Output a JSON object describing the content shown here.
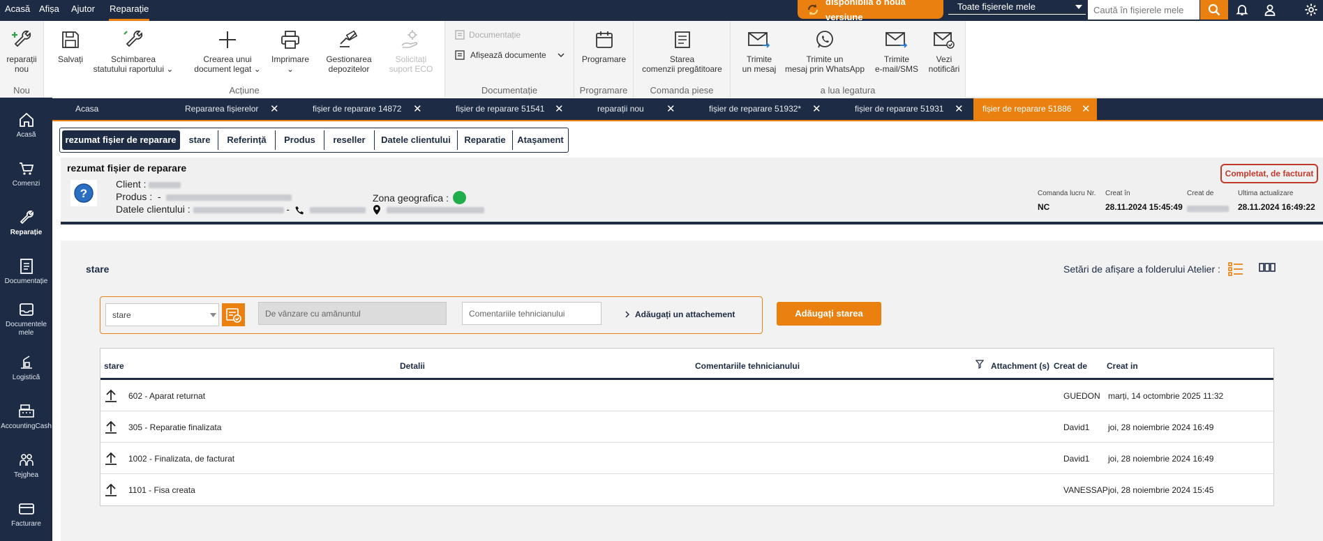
{
  "topbar": {
    "menus": [
      "Acasă",
      "Afișa",
      "Ajutor",
      "Reparație"
    ],
    "update_label": "disponibilă o nouă versiune",
    "file_select": "Toate fișierele mele",
    "search_placeholder": "Caută în fișierele mele"
  },
  "ribbon": {
    "groups": {
      "nou": "Nou",
      "actiune": "Acțiune",
      "documentatie": "Documentație",
      "programare": "Programare",
      "comanda": "Comanda piese",
      "legatura": "a lua legatura"
    },
    "buttons": {
      "reparatii_nou": [
        "reparații",
        "nou"
      ],
      "salvati": [
        "Salvați"
      ],
      "schimbarea": [
        "Schimbarea",
        "statutului raportului"
      ],
      "crearea": [
        "Crearea unui",
        "document legat"
      ],
      "imprimare": [
        "Imprimare"
      ],
      "gestionarea": [
        "Gestionarea",
        "depozitelor"
      ],
      "solicitati": [
        "Solicitați",
        "suport ECO"
      ],
      "documentatie": "Documentație",
      "afiseaza": "Afișează documente",
      "programare": [
        "Programare"
      ],
      "starea": [
        "Starea",
        "comenzii pregătitoare"
      ],
      "trimite_mesaj": [
        "Trimite",
        "un mesaj"
      ],
      "whatsapp": [
        "Trimite un",
        "mesaj prin WhatsApp"
      ],
      "email": [
        "Trimite",
        "e-mail/SMS"
      ],
      "notificari": [
        "Vezi",
        "notificări"
      ]
    }
  },
  "sidebar": [
    {
      "label": "Acasă",
      "icon": "home-icon"
    },
    {
      "label": "Comenzi",
      "icon": "cart-icon"
    },
    {
      "label": "Reparație",
      "icon": "wrench-icon"
    },
    {
      "label": "Documentație",
      "icon": "document-icon"
    },
    {
      "label": "Documentele mele",
      "icon": "inbox-icon"
    },
    {
      "label": "Logistică",
      "icon": "logistics-icon"
    },
    {
      "label": "AccountingCash",
      "icon": "cash-register-icon"
    },
    {
      "label": "Tejghea",
      "icon": "people-icon"
    },
    {
      "label": "Facturare",
      "icon": "card-icon"
    }
  ],
  "tabs": [
    {
      "label": "Acasa"
    },
    {
      "label": "Repararea fișierelor"
    },
    {
      "label": "fișier de reparare 14872"
    },
    {
      "label": "fișier de reparare 51541"
    },
    {
      "label": "reparații nou"
    },
    {
      "label": "fișier de reparare 51932*"
    },
    {
      "label": "fișier de reparare 51931"
    },
    {
      "label": "fișier de reparare 51886"
    }
  ],
  "subtabs": [
    "rezumat fișier de reparare",
    "stare",
    "Referință",
    "Produs",
    "reseller",
    "Datele clientului",
    "Reparatie",
    "Atașament"
  ],
  "header": {
    "title": "rezumat fișier de reparare",
    "client_label": "Client :",
    "produs_label": "Produs :",
    "produs_sep": "-",
    "datele_label": "Datele clientului :",
    "datele_sep": "-",
    "zona_label": "Zona geografica :",
    "status_badge": "Completat, de facturat",
    "meta": {
      "comanda_label": "Comanda lucru Nr.",
      "comanda_value": "NC",
      "creat_in_label": "Creat în",
      "creat_in_value": "28.11.2024 15:45:49",
      "creat_de_label": "Creat de",
      "ultima_label": "Ultima actualizare",
      "ultima_value": "28.11.2024 16:49:22"
    }
  },
  "stare": {
    "section_title": "stare",
    "display_settings": "Setări de afișare a folderului Atelier :",
    "stare_select": "stare",
    "retail_placeholder": "De vânzare cu amănuntul",
    "comment_placeholder": "Comentariile tehnicianului",
    "add_attachment": "Adăugați un attachement",
    "add_status": "Adăugați starea",
    "columns": [
      "stare",
      "Detalii",
      "Comentariile tehnicianului",
      "Attachment (s)",
      "Creat de",
      "Creat in"
    ],
    "rows": [
      {
        "stare": "602 - Aparat returnat",
        "creat_de": "GUEDON",
        "creat_in": "marți, 14 octombrie 2025 11:32"
      },
      {
        "stare": "305 - Reparatie finalizata",
        "creat_de": "David1",
        "creat_in": "joi, 28 noiembrie 2024 16:49"
      },
      {
        "stare": "1002 - Finalizata, de facturat",
        "creat_de": "David1",
        "creat_in": "joi, 28 noiembrie 2024 16:49"
      },
      {
        "stare": "1101 - Fisa creata",
        "creat_de": "VANESSAP",
        "creat_in": "joi, 28 noiembrie 2024 15:45"
      }
    ]
  },
  "colors": {
    "navy": "#1d2b44",
    "orange": "#e9800f",
    "badge_red": "#c0392b",
    "zone_green": "#1fae4b"
  }
}
